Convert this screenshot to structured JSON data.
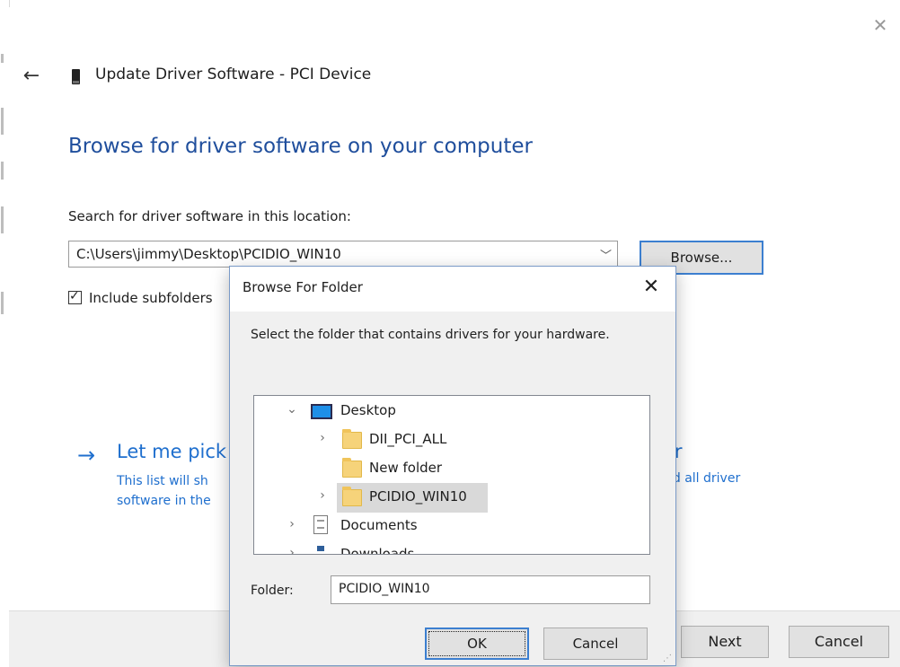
{
  "wizard": {
    "title": "Update Driver Software - PCI Device",
    "heading": "Browse for driver software on your computer",
    "search_label": "Search for driver software in this location:",
    "path_value": "C:\\Users\\jimmy\\Desktop\\PCIDIO_WIN10",
    "browse_label": "Browse...",
    "include_subfolders_label": "Include subfolders",
    "include_subfolders_checked": true,
    "pick_title_left": "Let me pick",
    "pick_title_right": "er",
    "pick_desc_line1_left": "This list will sh",
    "pick_desc_line1_right": "nd all driver",
    "pick_desc_line2_left": "software in the",
    "next_label": "Next",
    "cancel_label": "Cancel",
    "icons": {
      "back": "back-arrow-icon",
      "close": "close-icon",
      "device": "device-icon",
      "arrow": "arrow-right-icon"
    }
  },
  "dialog": {
    "title": "Browse For Folder",
    "instructions": "Select the folder that contains drivers for your hardware.",
    "tree": [
      {
        "label": "Desktop",
        "icon": "desktop-icon",
        "expander": "chevron-down",
        "level": 0
      },
      {
        "label": "DII_PCI_ALL",
        "icon": "folder-icon",
        "expander": "chevron-right",
        "level": 1
      },
      {
        "label": "New folder",
        "icon": "folder-icon",
        "expander": "",
        "level": 1
      },
      {
        "label": "PCIDIO_WIN10",
        "icon": "folder-icon",
        "expander": "chevron-right",
        "level": 1,
        "selected": true
      },
      {
        "label": "Documents",
        "icon": "documents-icon",
        "expander": "chevron-right",
        "level": 0
      },
      {
        "label": "Downloads",
        "icon": "downloads-icon",
        "expander": "chevron-right",
        "level": 0
      }
    ],
    "folder_label": "Folder:",
    "folder_value": "PCIDIO_WIN10",
    "ok_label": "OK",
    "cancel_label": "Cancel"
  },
  "colors": {
    "heading_blue": "#1f4e9c",
    "link_blue": "#1f6fce",
    "focus_blue": "#3c7fd0",
    "folder_yellow": "#f6d37a"
  }
}
